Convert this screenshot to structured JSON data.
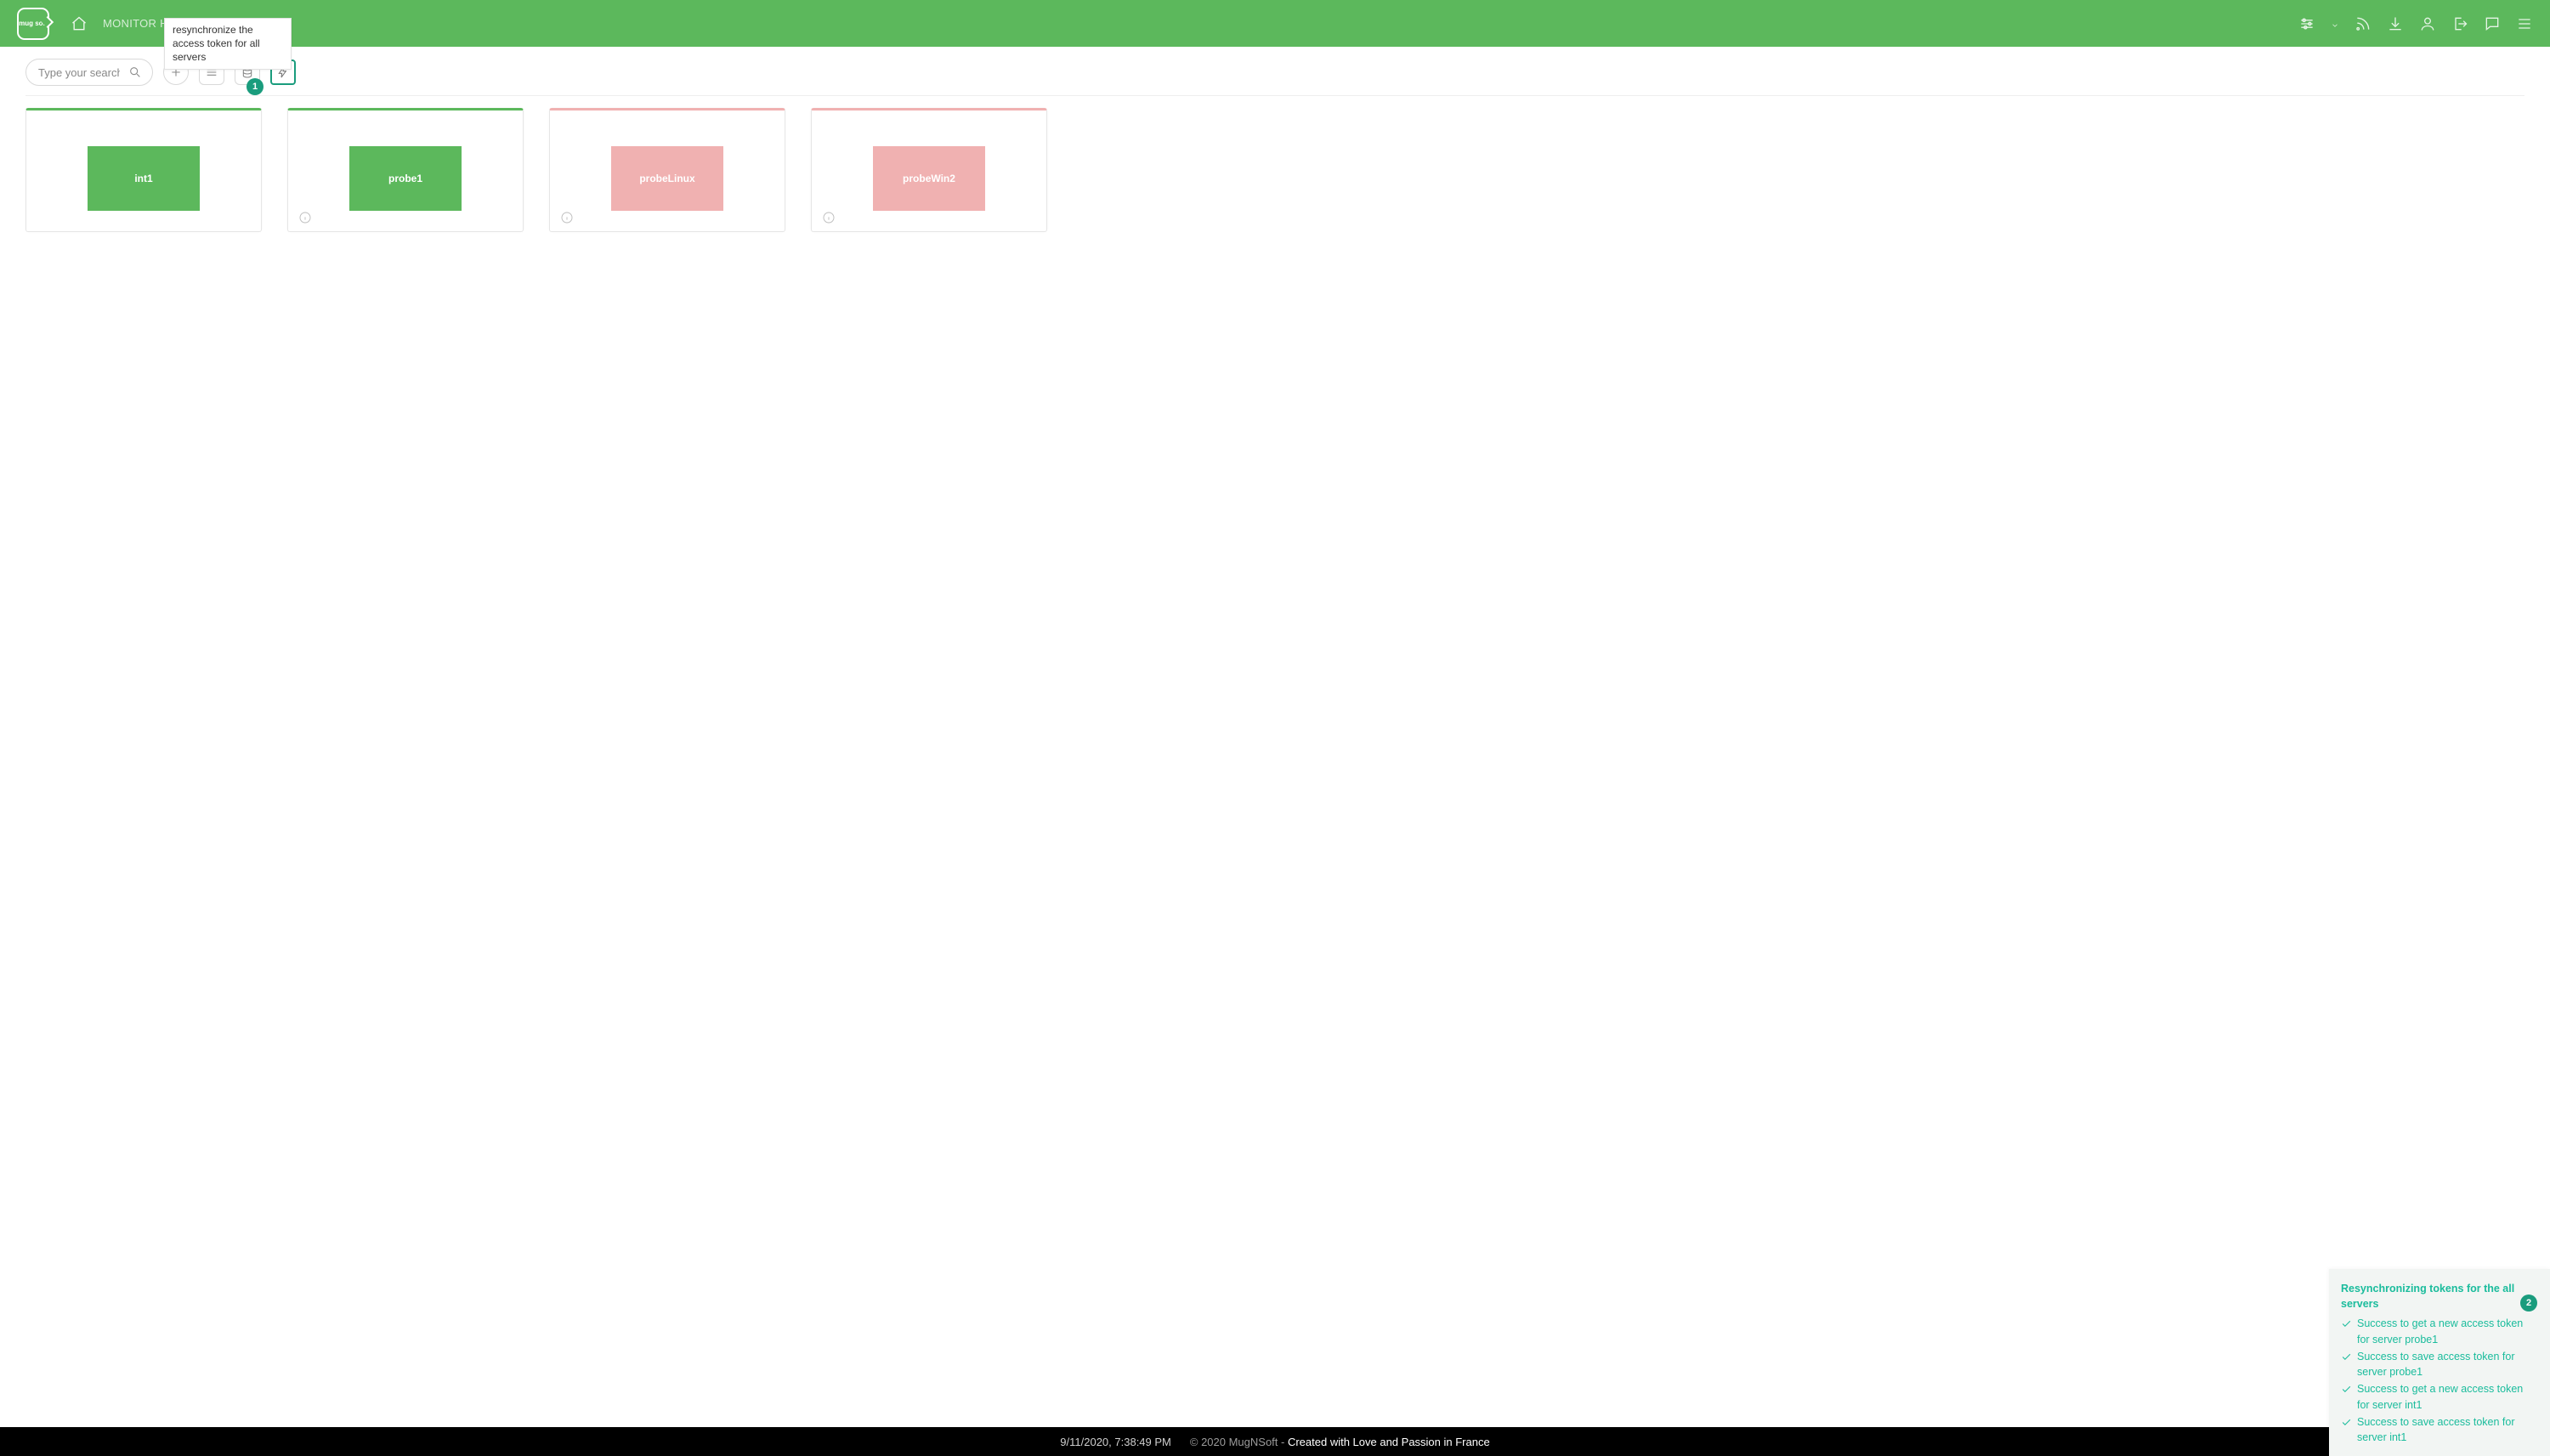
{
  "header": {
    "logo_text": "mug soft",
    "breadcrumb": "MONITOR HEALTH",
    "tooltip": "resynchronize the access token for all servers"
  },
  "toolbar": {
    "search_placeholder": "Type your search",
    "badge1": "1"
  },
  "cards": [
    {
      "name": "int1",
      "status": "green",
      "has_info": false
    },
    {
      "name": "probe1",
      "status": "green",
      "has_info": true
    },
    {
      "name": "probeLinux",
      "status": "pink",
      "has_info": true
    },
    {
      "name": "probeWin2",
      "status": "pink",
      "has_info": true
    }
  ],
  "footer": {
    "timestamp": "9/11/2020, 7:38:49 PM",
    "copyright": "© 2020 MugNSoft - ",
    "credit": "Created with Love and Passion in France"
  },
  "toast": {
    "badge": "2",
    "title": "Resynchronizing tokens for the all servers",
    "lines": [
      "Success to get a new access token for server probe1",
      "Success to save access token for server probe1",
      "Success to get a new access token for server int1",
      "Success to save access token for server int1"
    ]
  }
}
